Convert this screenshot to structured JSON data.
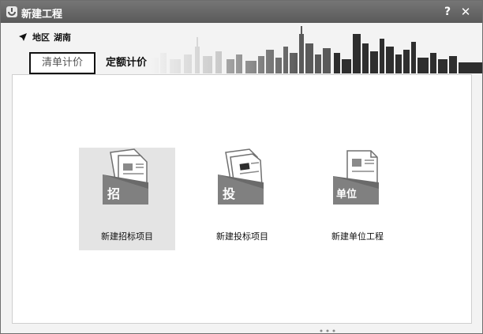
{
  "window": {
    "title": "新建工程",
    "help_label": "?",
    "close_label": "✕"
  },
  "region": {
    "label": "地区",
    "value": "湖南"
  },
  "tabs": [
    {
      "label": "清单计价",
      "active": true
    },
    {
      "label": "定额计价",
      "active": false
    }
  ],
  "cards": [
    {
      "icon_text": "招",
      "label": "新建招标项目",
      "icon": "bid-invite-document-icon",
      "selected": true
    },
    {
      "icon_text": "投",
      "label": "新建投标项目",
      "icon": "bid-submit-document-icon",
      "selected": false
    },
    {
      "icon_text": "单位",
      "label": "新建单位工程",
      "icon": "unit-project-document-icon",
      "selected": false
    }
  ],
  "colors": {
    "titlebar": "#676767",
    "folder": "#808080",
    "folder_dark": "#6a6a6a",
    "card_selected_bg": "#e4e4e4"
  }
}
